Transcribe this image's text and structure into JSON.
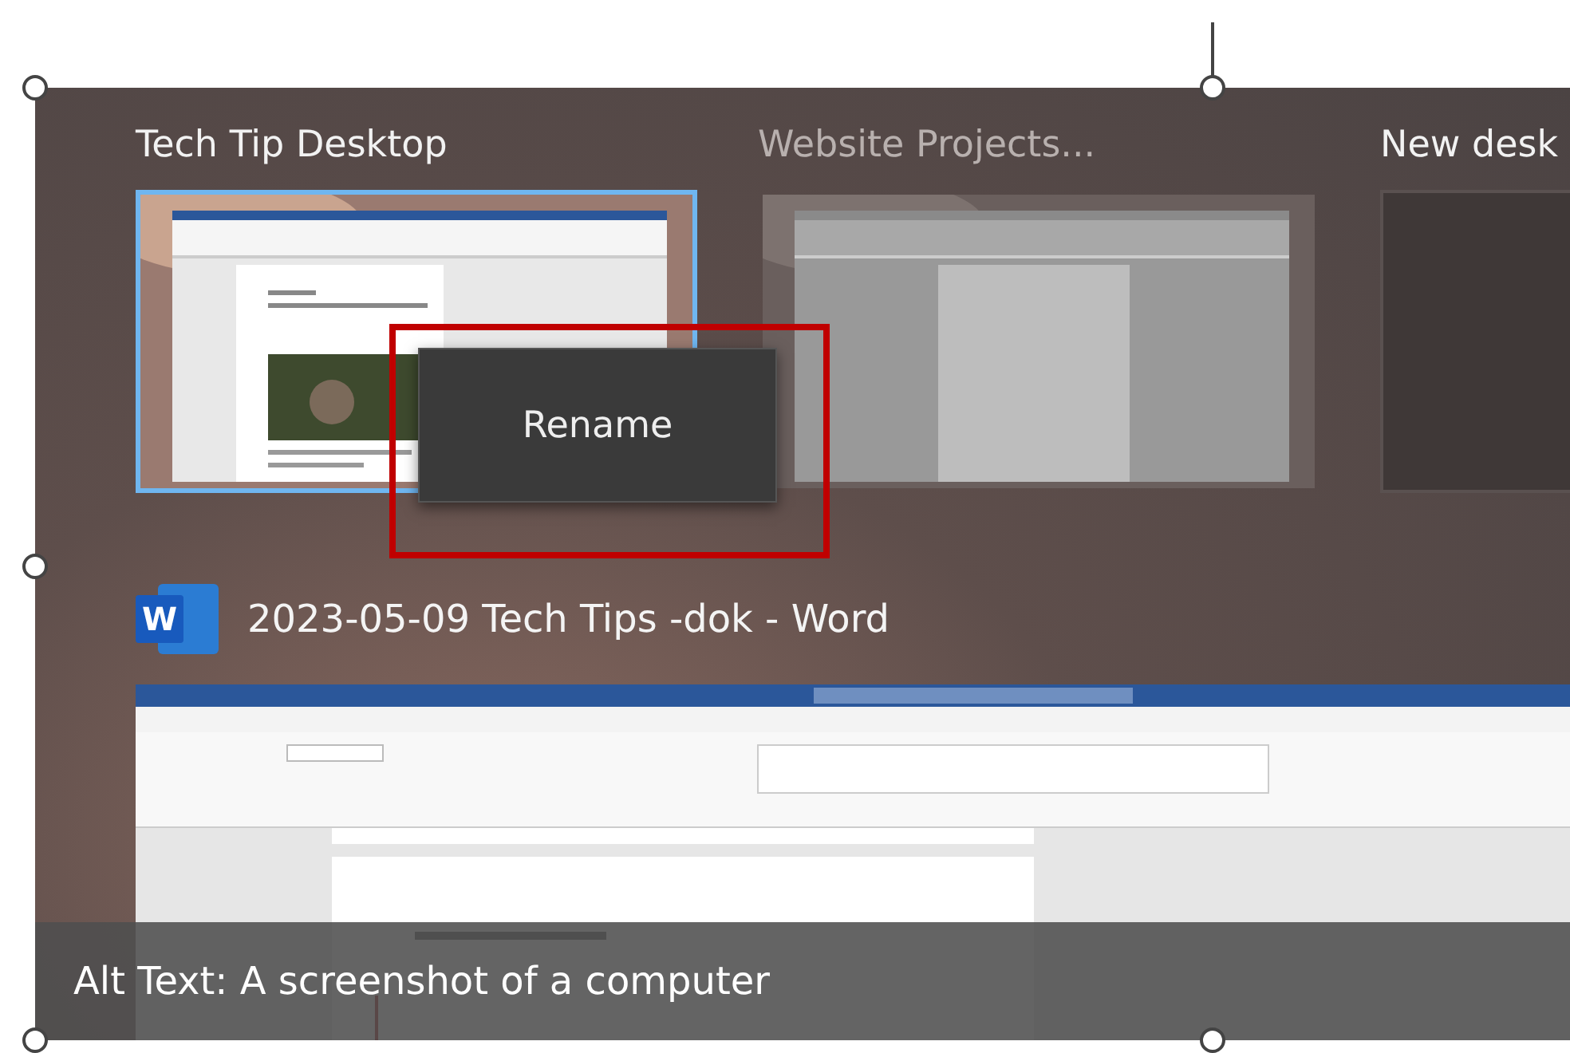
{
  "desktops": [
    {
      "label": "Tech Tip Desktop",
      "selected": true,
      "dimmed": false,
      "kind": "preview"
    },
    {
      "label": "Website Projects...",
      "selected": false,
      "dimmed": true,
      "kind": "preview"
    },
    {
      "label": "New desk",
      "selected": false,
      "dimmed": false,
      "kind": "empty"
    }
  ],
  "context_menu": {
    "items": [
      "Rename"
    ]
  },
  "window": {
    "title": "2023-05-09 Tech Tips -dok - Word",
    "app_icon": "W"
  },
  "alt_text": "Alt Text: A screenshot of a computer"
}
